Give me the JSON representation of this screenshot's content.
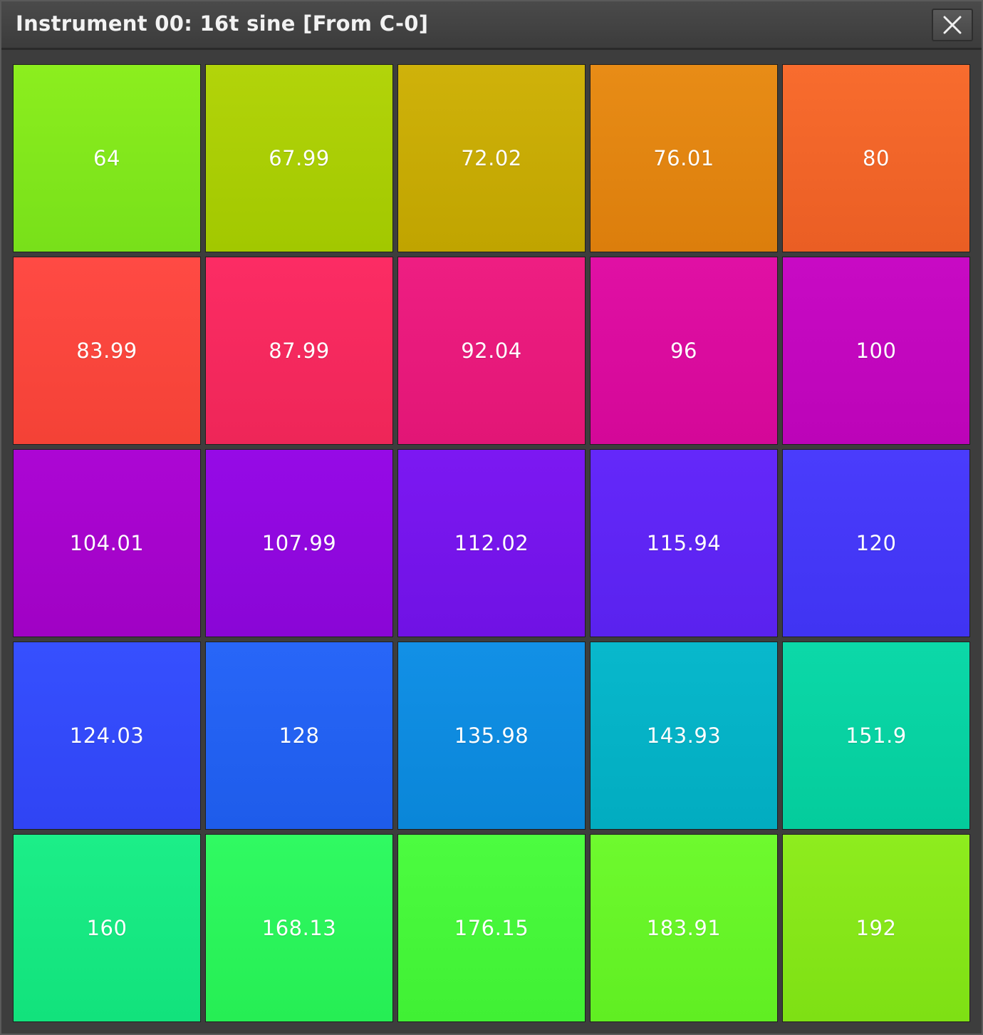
{
  "window": {
    "title": "Instrument 00: 16t sine [From C-0]",
    "close_icon": "close-icon"
  },
  "pads": [
    {
      "label": "64",
      "color_top": "#8cee1e",
      "color_bottom": "#78e01a"
    },
    {
      "label": "67.99",
      "color_top": "#b2d40a",
      "color_bottom": "#a2c800"
    },
    {
      "label": "72.02",
      "color_top": "#cfb20a",
      "color_bottom": "#c0a400"
    },
    {
      "label": "76.01",
      "color_top": "#e88c16",
      "color_bottom": "#dc7e0c"
    },
    {
      "label": "80",
      "color_top": "#f86c2e",
      "color_bottom": "#ea5e24"
    },
    {
      "label": "83.99",
      "color_top": "#ff4a44",
      "color_bottom": "#f44236"
    },
    {
      "label": "87.99",
      "color_top": "#fc2c64",
      "color_bottom": "#ee2658"
    },
    {
      "label": "92.04",
      "color_top": "#ee1e82",
      "color_bottom": "#e21676"
    },
    {
      "label": "96",
      "color_top": "#e010a4",
      "color_bottom": "#d40898"
    },
    {
      "label": "100",
      "color_top": "#c80ac4",
      "color_bottom": "#bc04b8"
    },
    {
      "label": "104.01",
      "color_top": "#ac06d4",
      "color_bottom": "#a002c4"
    },
    {
      "label": "107.99",
      "color_top": "#960ae6",
      "color_bottom": "#8a06d6"
    },
    {
      "label": "112.02",
      "color_top": "#7c18f2",
      "color_bottom": "#7012e4"
    },
    {
      "label": "115.94",
      "color_top": "#6428fa",
      "color_bottom": "#5a22ee"
    },
    {
      "label": "120",
      "color_top": "#4a3cfc",
      "color_bottom": "#4034f2"
    },
    {
      "label": "124.03",
      "color_top": "#3650fe",
      "color_bottom": "#3044f4"
    },
    {
      "label": "128",
      "color_top": "#2866f8",
      "color_bottom": "#1e5cea"
    },
    {
      "label": "135.98",
      "color_top": "#1290e6",
      "color_bottom": "#0a86d8"
    },
    {
      "label": "143.93",
      "color_top": "#08b8cc",
      "color_bottom": "#02acc0"
    },
    {
      "label": "151.9",
      "color_top": "#0cd8a8",
      "color_bottom": "#04cc9c"
    },
    {
      "label": "160",
      "color_top": "#1cee88",
      "color_bottom": "#12e27c"
    },
    {
      "label": "168.13",
      "color_top": "#30fa62",
      "color_bottom": "#26ee54"
    },
    {
      "label": "176.15",
      "color_top": "#4cfc40",
      "color_bottom": "#40f034"
    },
    {
      "label": "183.91",
      "color_top": "#6efa2e",
      "color_bottom": "#60ee22"
    },
    {
      "label": "192",
      "color_top": "#8eec1e",
      "color_bottom": "#7ee014"
    }
  ]
}
